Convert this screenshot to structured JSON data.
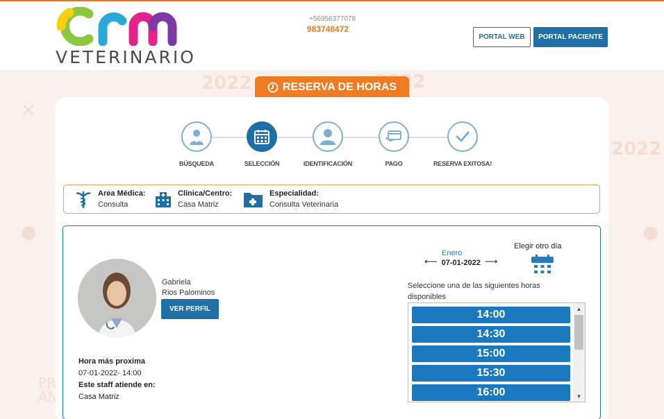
{
  "header": {
    "logo_word": "VETERINARIO",
    "logo_letters": "crm",
    "phone_small": "+56956377078",
    "phone_big": "983748472",
    "portal_web": "PORTAL WEB",
    "portal_paciente": "PORTAL PACIENTE"
  },
  "page_title": "RESERVA DE HORAS",
  "steps": [
    {
      "label": "BÚSQUEDA",
      "icon": "doctor-icon",
      "active": false
    },
    {
      "label": "SELECCIÓN",
      "icon": "calendar-icon",
      "active": true
    },
    {
      "label": "IDENTIFICACIÓN",
      "icon": "user-icon",
      "active": false
    },
    {
      "label": "PAGO",
      "icon": "payment-card-icon",
      "active": false
    },
    {
      "label": "RESERVA EXITOSA!",
      "icon": "check-icon",
      "active": false
    }
  ],
  "info": {
    "area_title": "Area Médica:",
    "area_value": "Consulta",
    "clinica_title": "Clínica/Centro:",
    "clinica_value": "Casa Matriz",
    "especialidad_title": "Especialidad:",
    "especialidad_value": "Consulta Veterinaria"
  },
  "doctor": {
    "first_name": "Gabriela",
    "last_name": "Rios Palominos",
    "profile_button": "VER PERFIL",
    "next_label": "Hora más proxima",
    "next_value": "07-01-2022- 14:00",
    "attends_label": "Este staff atiende en:",
    "attends_value": "Casa Matriz"
  },
  "schedule": {
    "month": "Enero",
    "date": "07-01-2022",
    "other_day": "Elegir otro día",
    "hint": "Seleccione una de las siguientes horas disponibles",
    "times": [
      "14:00",
      "14:30",
      "15:00",
      "15:30",
      "16:00"
    ]
  },
  "colors": {
    "primary": "#1f6ea5",
    "accent": "#ef7b22",
    "time_button": "#1a78bf"
  },
  "background_text": [
    "2022",
    "2022",
    "2022",
    "PR",
    "AN"
  ]
}
